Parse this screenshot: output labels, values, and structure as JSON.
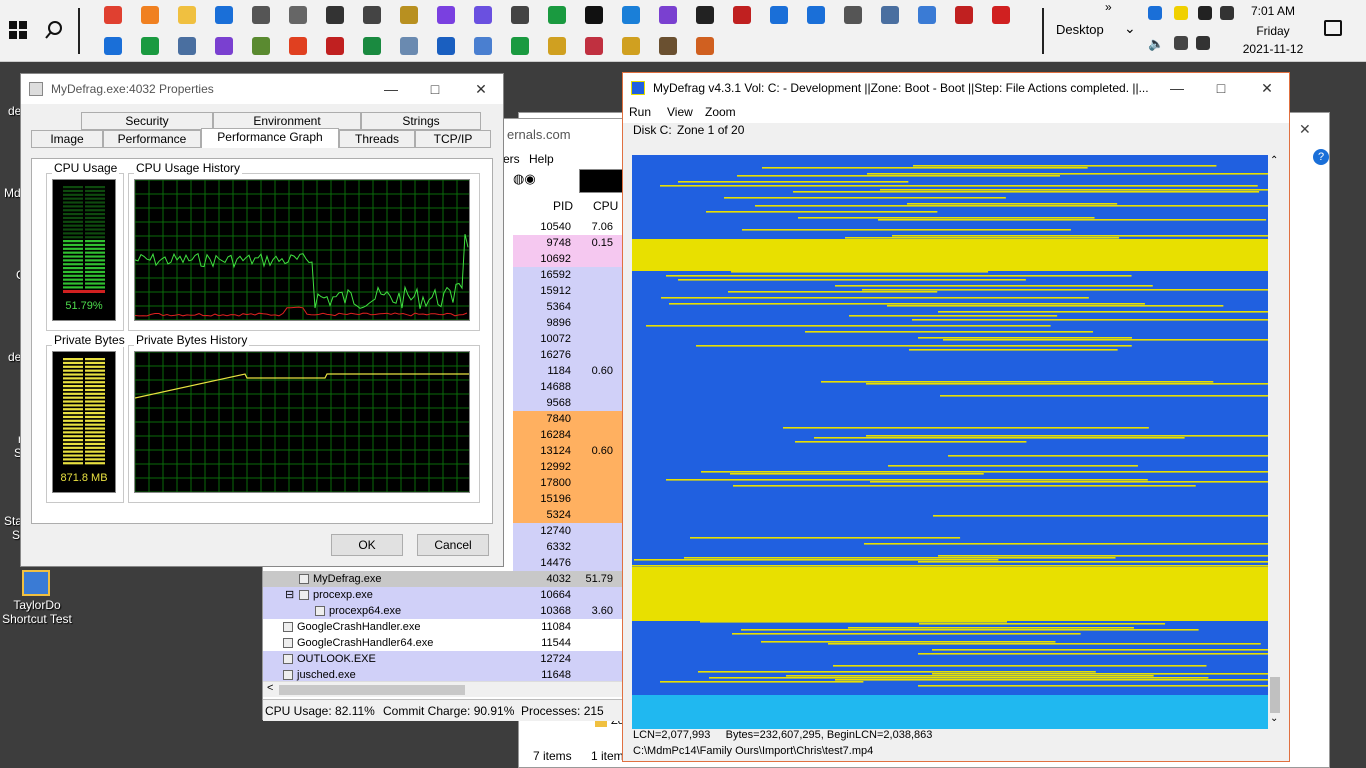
{
  "taskbar": {
    "desktop_label": "Desktop",
    "time": "7:01 AM",
    "day": "Friday",
    "date": "2021-11-12",
    "expand": "»"
  },
  "desktop": {
    "icon_label_line1": "TaylorDo",
    "icon_label_line2": "Shortcut Test",
    "partial_labels": [
      "de",
      "Md",
      "C",
      "de",
      "r",
      "S",
      "Sta",
      "S"
    ]
  },
  "procexp": {
    "title_fragment": "ernals.com",
    "menu_help": "Help",
    "menu_fragment": "ers",
    "col_pid": "PID",
    "col_cpu": "CPU",
    "rows": [
      {
        "pid": "10540",
        "cpu": "7.06",
        "bg": "#ffffff"
      },
      {
        "pid": "9748",
        "cpu": "0.15",
        "bg": "#f5c8f0"
      },
      {
        "pid": "10692",
        "cpu": "",
        "bg": "#f5c8f0"
      },
      {
        "pid": "16592",
        "cpu": "",
        "bg": "#d0d0f8"
      },
      {
        "pid": "15912",
        "cpu": "",
        "bg": "#d0d0f8"
      },
      {
        "pid": "5364",
        "cpu": "",
        "bg": "#d0d0f8"
      },
      {
        "pid": "9896",
        "cpu": "",
        "bg": "#d0d0f8"
      },
      {
        "pid": "10072",
        "cpu": "",
        "bg": "#d0d0f8"
      },
      {
        "pid": "16276",
        "cpu": "",
        "bg": "#d0d0f8"
      },
      {
        "pid": "1184",
        "cpu": "0.60",
        "bg": "#d0d0f8"
      },
      {
        "pid": "14688",
        "cpu": "",
        "bg": "#d0d0f8"
      },
      {
        "pid": "9568",
        "cpu": "",
        "bg": "#d0d0f8"
      },
      {
        "pid": "7840",
        "cpu": "",
        "bg": "#ffb060"
      },
      {
        "pid": "16284",
        "cpu": "",
        "bg": "#ffb060"
      },
      {
        "pid": "13124",
        "cpu": "0.60",
        "bg": "#ffb060"
      },
      {
        "pid": "12992",
        "cpu": "",
        "bg": "#ffb060"
      },
      {
        "pid": "17800",
        "cpu": "",
        "bg": "#ffb060"
      },
      {
        "pid": "15196",
        "cpu": "",
        "bg": "#ffb060"
      },
      {
        "pid": "5324",
        "cpu": "",
        "bg": "#ffb060"
      },
      {
        "pid": "12740",
        "cpu": "",
        "bg": "#d0d0f8"
      },
      {
        "pid": "6332",
        "cpu": "",
        "bg": "#d0d0f8"
      },
      {
        "pid": "14476",
        "cpu": "",
        "bg": "#d0d0f8"
      }
    ],
    "named_rows": [
      {
        "name": "MyDefrag.exe",
        "pid": "4032",
        "cpu": "51.79",
        "bg": "#c8c8c8",
        "indent": 50,
        "expander": ""
      },
      {
        "name": "procexp.exe",
        "pid": "10664",
        "cpu": "",
        "bg": "#d0d0f8",
        "indent": 50,
        "expander": "⊟"
      },
      {
        "name": "procexp64.exe",
        "pid": "10368",
        "cpu": "3.60",
        "bg": "#d0d0f8",
        "indent": 66,
        "expander": ""
      },
      {
        "name": "GoogleCrashHandler.exe",
        "pid": "11084",
        "cpu": "",
        "bg": "#ffffff",
        "indent": 34,
        "expander": ""
      },
      {
        "name": "GoogleCrashHandler64.exe",
        "pid": "11544",
        "cpu": "",
        "bg": "#ffffff",
        "indent": 34,
        "expander": ""
      },
      {
        "name": "OUTLOOK.EXE",
        "pid": "12724",
        "cpu": "",
        "bg": "#d0d0f8",
        "indent": 34,
        "expander": ""
      },
      {
        "name": "jusched.exe",
        "pid": "11648",
        "cpu": "",
        "bg": "#d0d0f8",
        "indent": 34,
        "expander": ""
      }
    ],
    "status_cpu": "CPU Usage: 82.11%",
    "status_commit": "Commit Charge: 90.91%",
    "status_procs": "Processes: 215"
  },
  "explorer_fragment": {
    "items": "7 items",
    "items2": "1 item",
    "folder": "Zo"
  },
  "props": {
    "title": "MyDefrag.exe:4032 Properties",
    "tabs_row1": [
      "Security",
      "Environment",
      "Strings"
    ],
    "tabs_row2": [
      "Image",
      "Performance",
      "Performance Graph",
      "Threads",
      "TCP/IP"
    ],
    "cpu_usage_label": "CPU Usage",
    "cpu_history_label": "CPU Usage History",
    "cpu_value": "51.79%",
    "cpu_fraction": 0.5179,
    "private_bytes_label": "Private Bytes",
    "private_history_label": "Private Bytes History",
    "private_value": "871.8 MB",
    "ok_label": "OK",
    "cancel_label": "Cancel"
  },
  "mydefrag": {
    "title": "MyDefrag v4.3.1   Vol: C: - Development ||Zone: Boot - Boot ||Step: File Actions completed. ||...",
    "menu": [
      "Run",
      "View",
      "Zoom"
    ],
    "disk_label": "Disk C:",
    "zone_label": "Zone 1 of 20",
    "status_line1": "LCN=2,077,993     Bytes=232,607,295, BeginLCN=2,038,863",
    "status_line2": "C:\\MdmPc14\\Family Ours\\Import\\Chris\\test7.mp4",
    "color_free": "#2060e0",
    "color_used": "#e8e000",
    "color_tail": "#20b8f0"
  }
}
